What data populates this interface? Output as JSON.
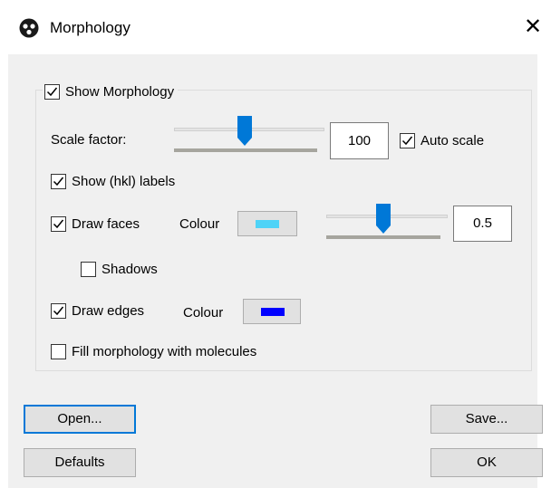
{
  "window": {
    "title": "Morphology",
    "close_glyph": "✕",
    "icon": "morphology-app-icon"
  },
  "group": {
    "label": "Show Morphology",
    "checked": true
  },
  "scale": {
    "label": "Scale factor:",
    "slider_level": 0.55,
    "value": "100",
    "auto_scale": {
      "label": "Auto scale",
      "checked": true
    }
  },
  "options": {
    "show_hkl": {
      "label": "Show (hkl) labels",
      "checked": true
    },
    "draw_faces": {
      "label": "Draw faces",
      "checked": true,
      "colour_label": "Colour",
      "colour": "#4fd3f7",
      "opacity_level": 0.5,
      "opacity_value": "0.5"
    },
    "shadows": {
      "label": "Shadows",
      "checked": false
    },
    "draw_edges": {
      "label": "Draw edges",
      "checked": true,
      "colour_label": "Colour",
      "colour": "#0000ff"
    },
    "fill_molecules": {
      "label": "Fill morphology with molecules",
      "checked": false
    }
  },
  "buttons": {
    "open": "Open...",
    "save": "Save...",
    "defaults": "Defaults",
    "ok": "OK"
  }
}
